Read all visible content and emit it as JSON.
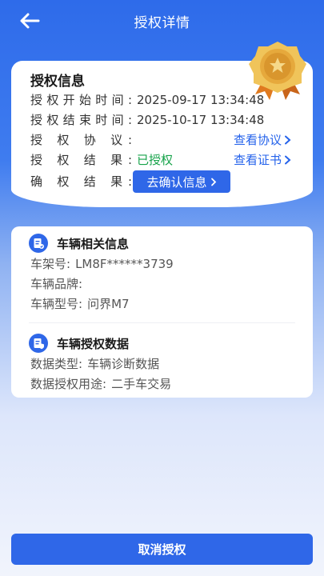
{
  "header": {
    "title": "授权详情"
  },
  "auth_info": {
    "title": "授权信息",
    "start_label": "授权开始时间:",
    "start_value": "2025-09-17 13:34:48",
    "end_label": "授权结束时间:",
    "end_value": "2025-10-17 13:34:48",
    "agreement_label": "授 权 协 议:",
    "agreement_link": "查看协议",
    "result_label": "授 权 结 果:",
    "result_value": "已授权",
    "certificate_link": "查看证书",
    "confirm_label": "确 权 结 果:",
    "confirm_button": "去确认信息",
    "status_color": "#16a34a",
    "link_color": "#2563eb"
  },
  "vehicle_info": {
    "title": "车辆相关信息",
    "vin_label": "车架号:",
    "vin_value": "LM8F******3739",
    "brand_label": "车辆品牌:",
    "brand_value": "",
    "model_label": "车辆型号:",
    "model_value": "问界M7"
  },
  "auth_data": {
    "title": "车辆授权数据",
    "type_label": "数据类型:",
    "type_value": "车辆诊断数据",
    "purpose_label": "数据授权用途:",
    "purpose_value": "二手车交易"
  },
  "footer": {
    "cancel_button": "取消授权",
    "accent": "#2f67e8"
  }
}
